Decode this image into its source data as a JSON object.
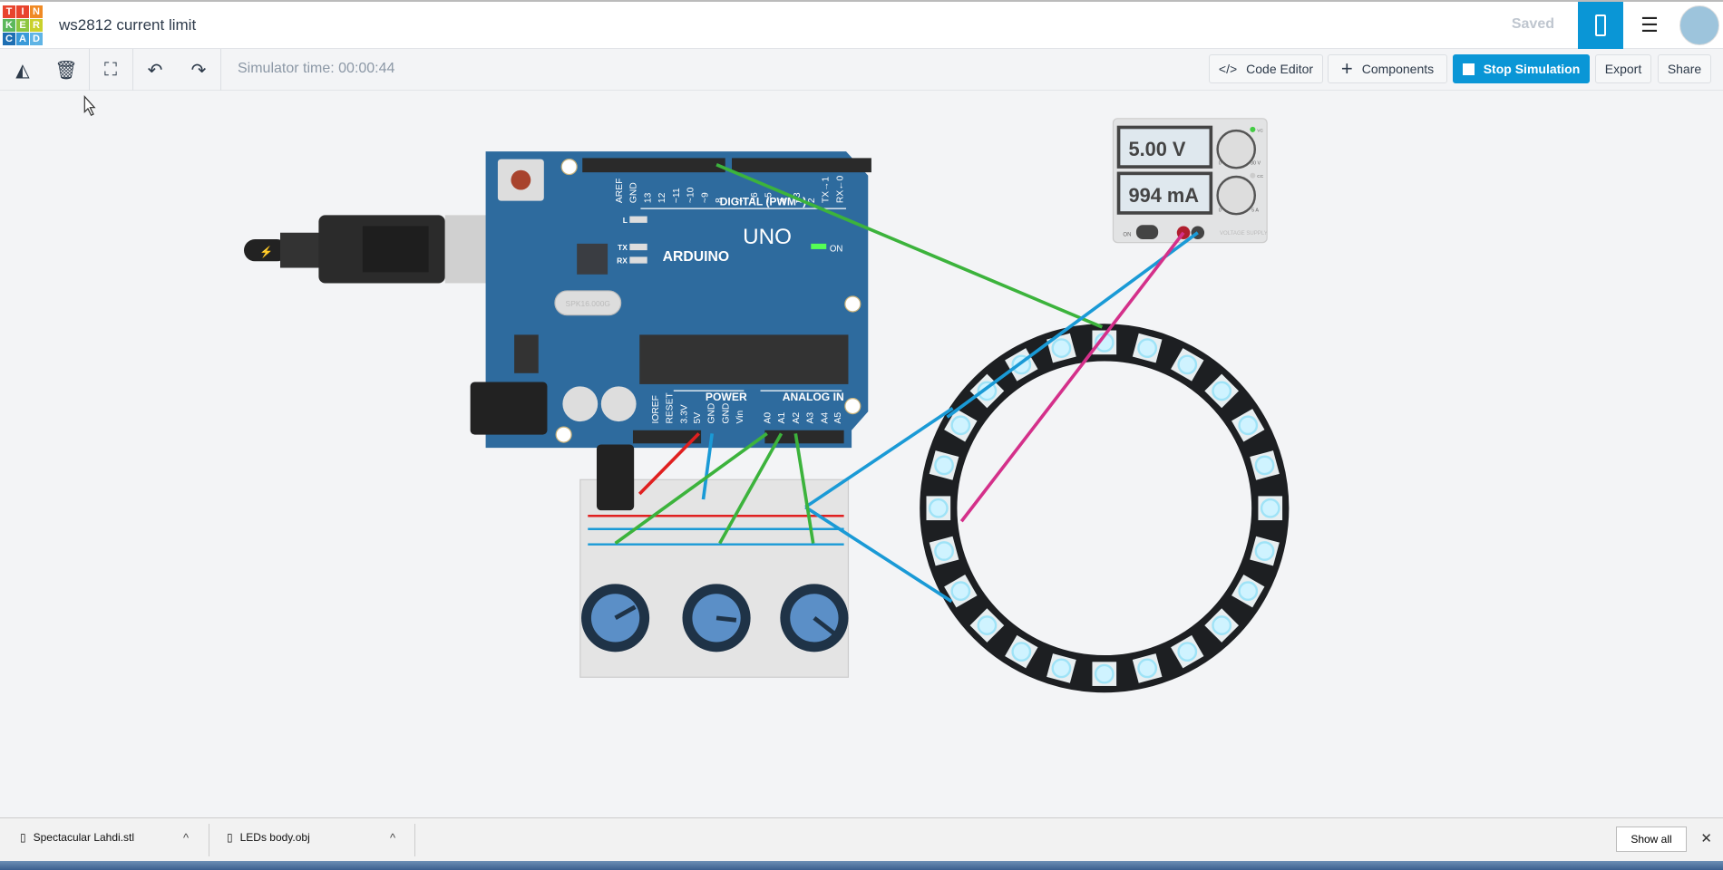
{
  "header": {
    "logo_letters": [
      "T",
      "I",
      "N",
      "K",
      "E",
      "R",
      "C",
      "A",
      "D"
    ],
    "logo_colors": [
      "#e8442e",
      "#e8442e",
      "#f08a24",
      "#5cb85c",
      "#8cc63f",
      "#c9d12c",
      "#1e6fb3",
      "#3a9ad9",
      "#5fb4e5"
    ],
    "title": "ws2812 current limit",
    "status": "Saved",
    "view_circuit_icon": "circuit-view-icon",
    "view_list_icon": "component-list-icon"
  },
  "toolbar": {
    "rotate": "rotate-icon",
    "delete": "trash-icon",
    "fit": "fit-view-icon",
    "undo": "undo-icon",
    "redo": "redo-icon",
    "sim_time": "Simulator time: 00:00:44",
    "code_editor": "Code Editor",
    "components": "Components",
    "stop_simulation": "Stop Simulation",
    "export": "Export",
    "share": "Share"
  },
  "colors": {
    "accent": "#0a96d6",
    "board": "#2e6b9e",
    "wire_green": "#3cb33c",
    "wire_blue": "#1a9ad6",
    "wire_red": "#e02020",
    "wire_pink": "#d4308a",
    "led": "#cff3ff"
  },
  "arduino": {
    "brand": "ARDUINO",
    "model": "UNO",
    "digital_label": "DIGITAL (PWM~)",
    "power_label": "POWER",
    "analog_label": "ANALOG IN",
    "digital_pins": [
      "AREF",
      "GND",
      "13",
      "12",
      "~11",
      "~10",
      "~9",
      "8",
      "7",
      "~6",
      "~5",
      "4",
      "~3",
      "2",
      "TX→1",
      "RX←0"
    ],
    "power_pins": [
      "IOREF",
      "RESET",
      "3.3V",
      "5V",
      "GND",
      "GND",
      "Vin"
    ],
    "analog_pins": [
      "A0",
      "A1",
      "A2",
      "A3",
      "A4",
      "A5"
    ],
    "leds": [
      "L",
      "TX",
      "RX",
      "ON"
    ],
    "crystal": "SPK16.000G"
  },
  "power_supply": {
    "voltage": "5.00 V",
    "current": "994 mA",
    "switch": "ON",
    "label": "VOLTAGE SUPPLY",
    "v_mode": "VC",
    "c_mode": "CC",
    "v_min": "0",
    "v_max": "30 V",
    "c_min": "0",
    "c_max": "5 A"
  },
  "ring": {
    "led_count": 24
  },
  "downloads": {
    "items": [
      {
        "name": "Spectacular Lahdi.stl"
      },
      {
        "name": "LEDs body.obj"
      }
    ],
    "show_all": "Show all",
    "close": "✕"
  }
}
